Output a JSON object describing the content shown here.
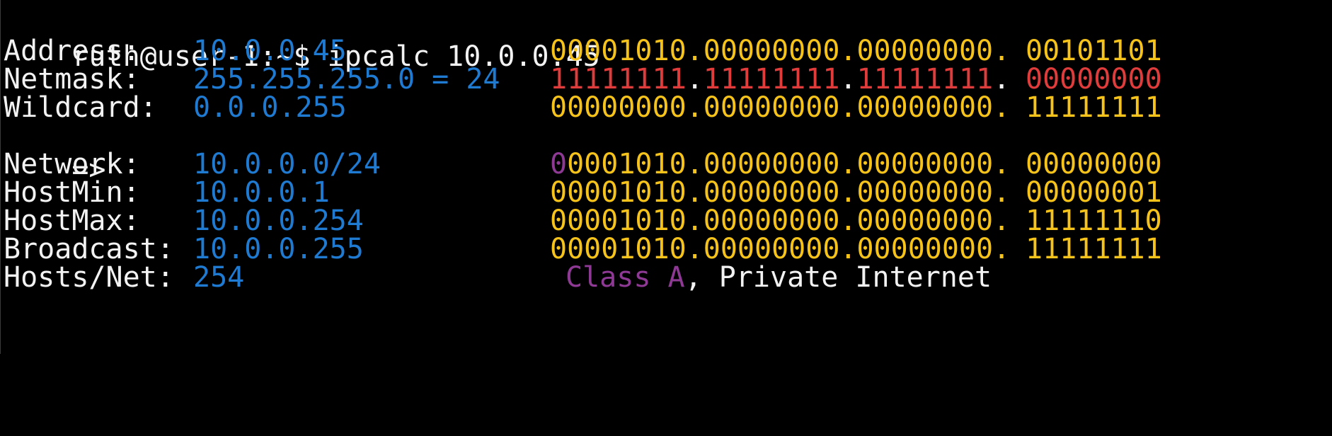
{
  "terminal": {
    "prompt": "ruth@user-1:~$ ipcalc 10.0.0.45",
    "arrow": "=>",
    "rows": [
      {
        "label": "Address:",
        "value": "10.0.0.45",
        "binary_net": "00001010.00000000.00000000.",
        "binary_host": "00101101"
      },
      {
        "label": "Netmask:",
        "value": "255.255.255.0 = 24",
        "binary_net": [
          "11111111",
          "11111111",
          "11111111"
        ],
        "binary_host": "00000000"
      },
      {
        "label": "Wildcard:",
        "value": "0.0.0.255",
        "binary_net": "00000000.00000000.00000000.",
        "binary_host": "11111111"
      },
      {
        "label": "Network:",
        "value": "10.0.0.0/24",
        "binary_class_bit": "0",
        "binary_net_rest": "0001010.00000000.00000000.",
        "binary_host": "00000000"
      },
      {
        "label": "HostMin:",
        "value": "10.0.0.1",
        "binary_net": "00001010.00000000.00000000.",
        "binary_host": "00000001"
      },
      {
        "label": "HostMax:",
        "value": "10.0.0.254",
        "binary_net": "00001010.00000000.00000000.",
        "binary_host": "11111110"
      },
      {
        "label": "Broadcast:",
        "value": "10.0.0.255",
        "binary_net": "00001010.00000000.00000000.",
        "binary_host": "11111111"
      },
      {
        "label": "Hosts/Net:",
        "value": "254",
        "class_text": "Class A",
        "class_suffix": ", Private Internet"
      }
    ],
    "colors": {
      "background": "#000000",
      "label": "#f2f2f2",
      "value": "#1f7ad1",
      "binary": "#f6c31b",
      "netmask": "#e03c3c",
      "class": "#8e3a95"
    }
  }
}
